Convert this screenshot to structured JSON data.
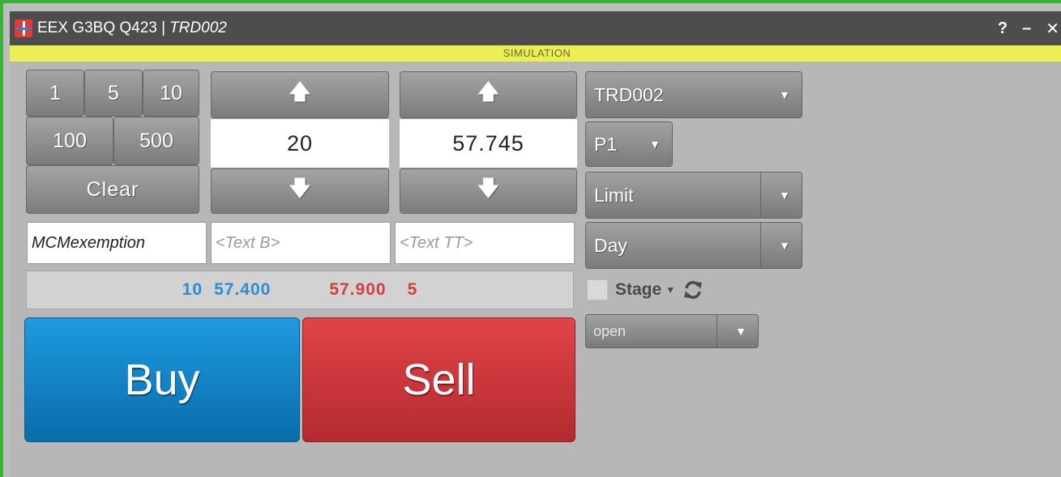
{
  "window": {
    "title": "EEX G3BQ Q423 | ",
    "trader": "TRD002",
    "controls": {
      "help": "?",
      "minimize": "–",
      "close": "✕"
    }
  },
  "mode_banner": "SIMULATION",
  "quantity_presets": [
    "1",
    "5",
    "10",
    "100",
    "500"
  ],
  "clear_label": "Clear",
  "quantity": {
    "value": "20",
    "up": "🡅",
    "down": "🡇"
  },
  "price": {
    "value": "57.745",
    "up": "🡅",
    "down": "🡇"
  },
  "text_fields": [
    {
      "value": "MCMexemption",
      "placeholder": ""
    },
    {
      "value": "",
      "placeholder": "<Text B>"
    },
    {
      "value": "",
      "placeholder": "<Text TT>"
    }
  ],
  "market_depth": {
    "bid_qty": "10",
    "bid_price": "57.400",
    "ask_price": "57.900",
    "ask_qty": "5"
  },
  "buy_label": "Buy",
  "sell_label": "Sell",
  "dropdowns": {
    "account": "TRD002",
    "product": "P1",
    "order_type": "Limit",
    "validity": "Day",
    "arrow": "▼"
  },
  "stage": {
    "label": "Stage",
    "caret": "▼",
    "checked": false
  },
  "status": {
    "value": "open",
    "arrow": "▼"
  },
  "colors": {
    "title_bar": "#4d4d4d",
    "simulation_bar": "#eaef52",
    "buy": "#1490d6",
    "sell": "#cc363b",
    "bid_text": "#2a8fd1",
    "ask_text": "#d13f3f",
    "frame": "#38b23a"
  }
}
